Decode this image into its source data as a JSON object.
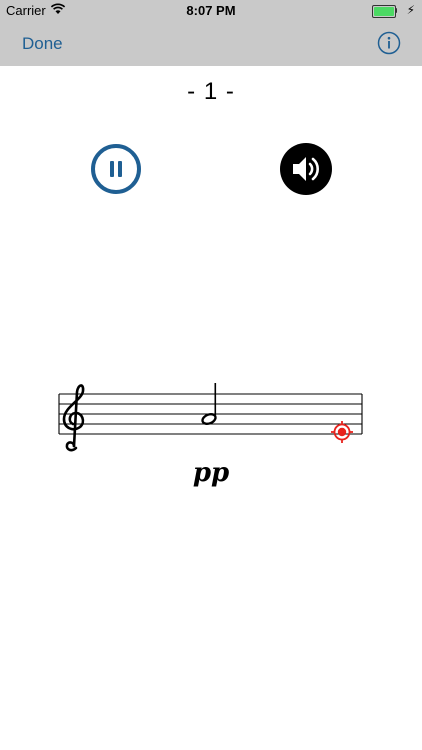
{
  "status_bar": {
    "carrier": "Carrier",
    "time": "8:07 PM",
    "battery_level": 1.0,
    "battery_color": "#4cd964"
  },
  "nav": {
    "done_label": "Done",
    "info_icon": "info-circle-icon",
    "accent_color": "#1f5f93",
    "bar_color": "#c9c9c9"
  },
  "exercise": {
    "counter": "- 1 -",
    "dynamic_marking": "pp"
  },
  "controls": {
    "pause_icon": "pause-circle-icon",
    "speaker_icon": "speaker-icon",
    "pause_color": "#1f5f93"
  },
  "staff": {
    "clef": "treble",
    "note": "half-note",
    "target_marker_color": "#e8231d"
  }
}
